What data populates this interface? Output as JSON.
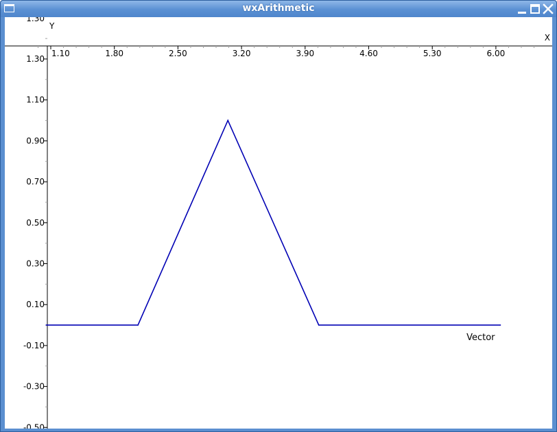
{
  "window": {
    "title": "wxArithmetic",
    "icons": [
      "window-menu-icon",
      "minimize-icon",
      "maximize-icon",
      "close-icon"
    ]
  },
  "colors": {
    "titlebar": "#5a90d3",
    "series": "#0000b4",
    "axis": "#000000",
    "tick": "#a0a0a0"
  },
  "chart_data": {
    "type": "line",
    "title": "",
    "xlabel": "X",
    "ylabel": "Y",
    "xlim": [
      1.03,
      6.55
    ],
    "ylim": [
      -0.5,
      1.37
    ],
    "x_ticks": [
      "1.10",
      "1.80",
      "2.50",
      "3.20",
      "3.90",
      "4.60",
      "5.30",
      "6.00"
    ],
    "y_ticks": [
      "1.30",
      "1.10",
      "0.90",
      "0.70",
      "0.50",
      "0.30",
      "0.10",
      "-0.10",
      "-0.30",
      "-0.50"
    ],
    "y_tick_overflow": "1.30",
    "legend_placement": "bottom-right",
    "grid": false,
    "series": [
      {
        "name": "Vector",
        "x": [
          1.05,
          2.06,
          3.05,
          4.05,
          6.05
        ],
        "y": [
          0.0,
          0.0,
          1.0,
          0.0,
          0.0
        ]
      }
    ]
  }
}
